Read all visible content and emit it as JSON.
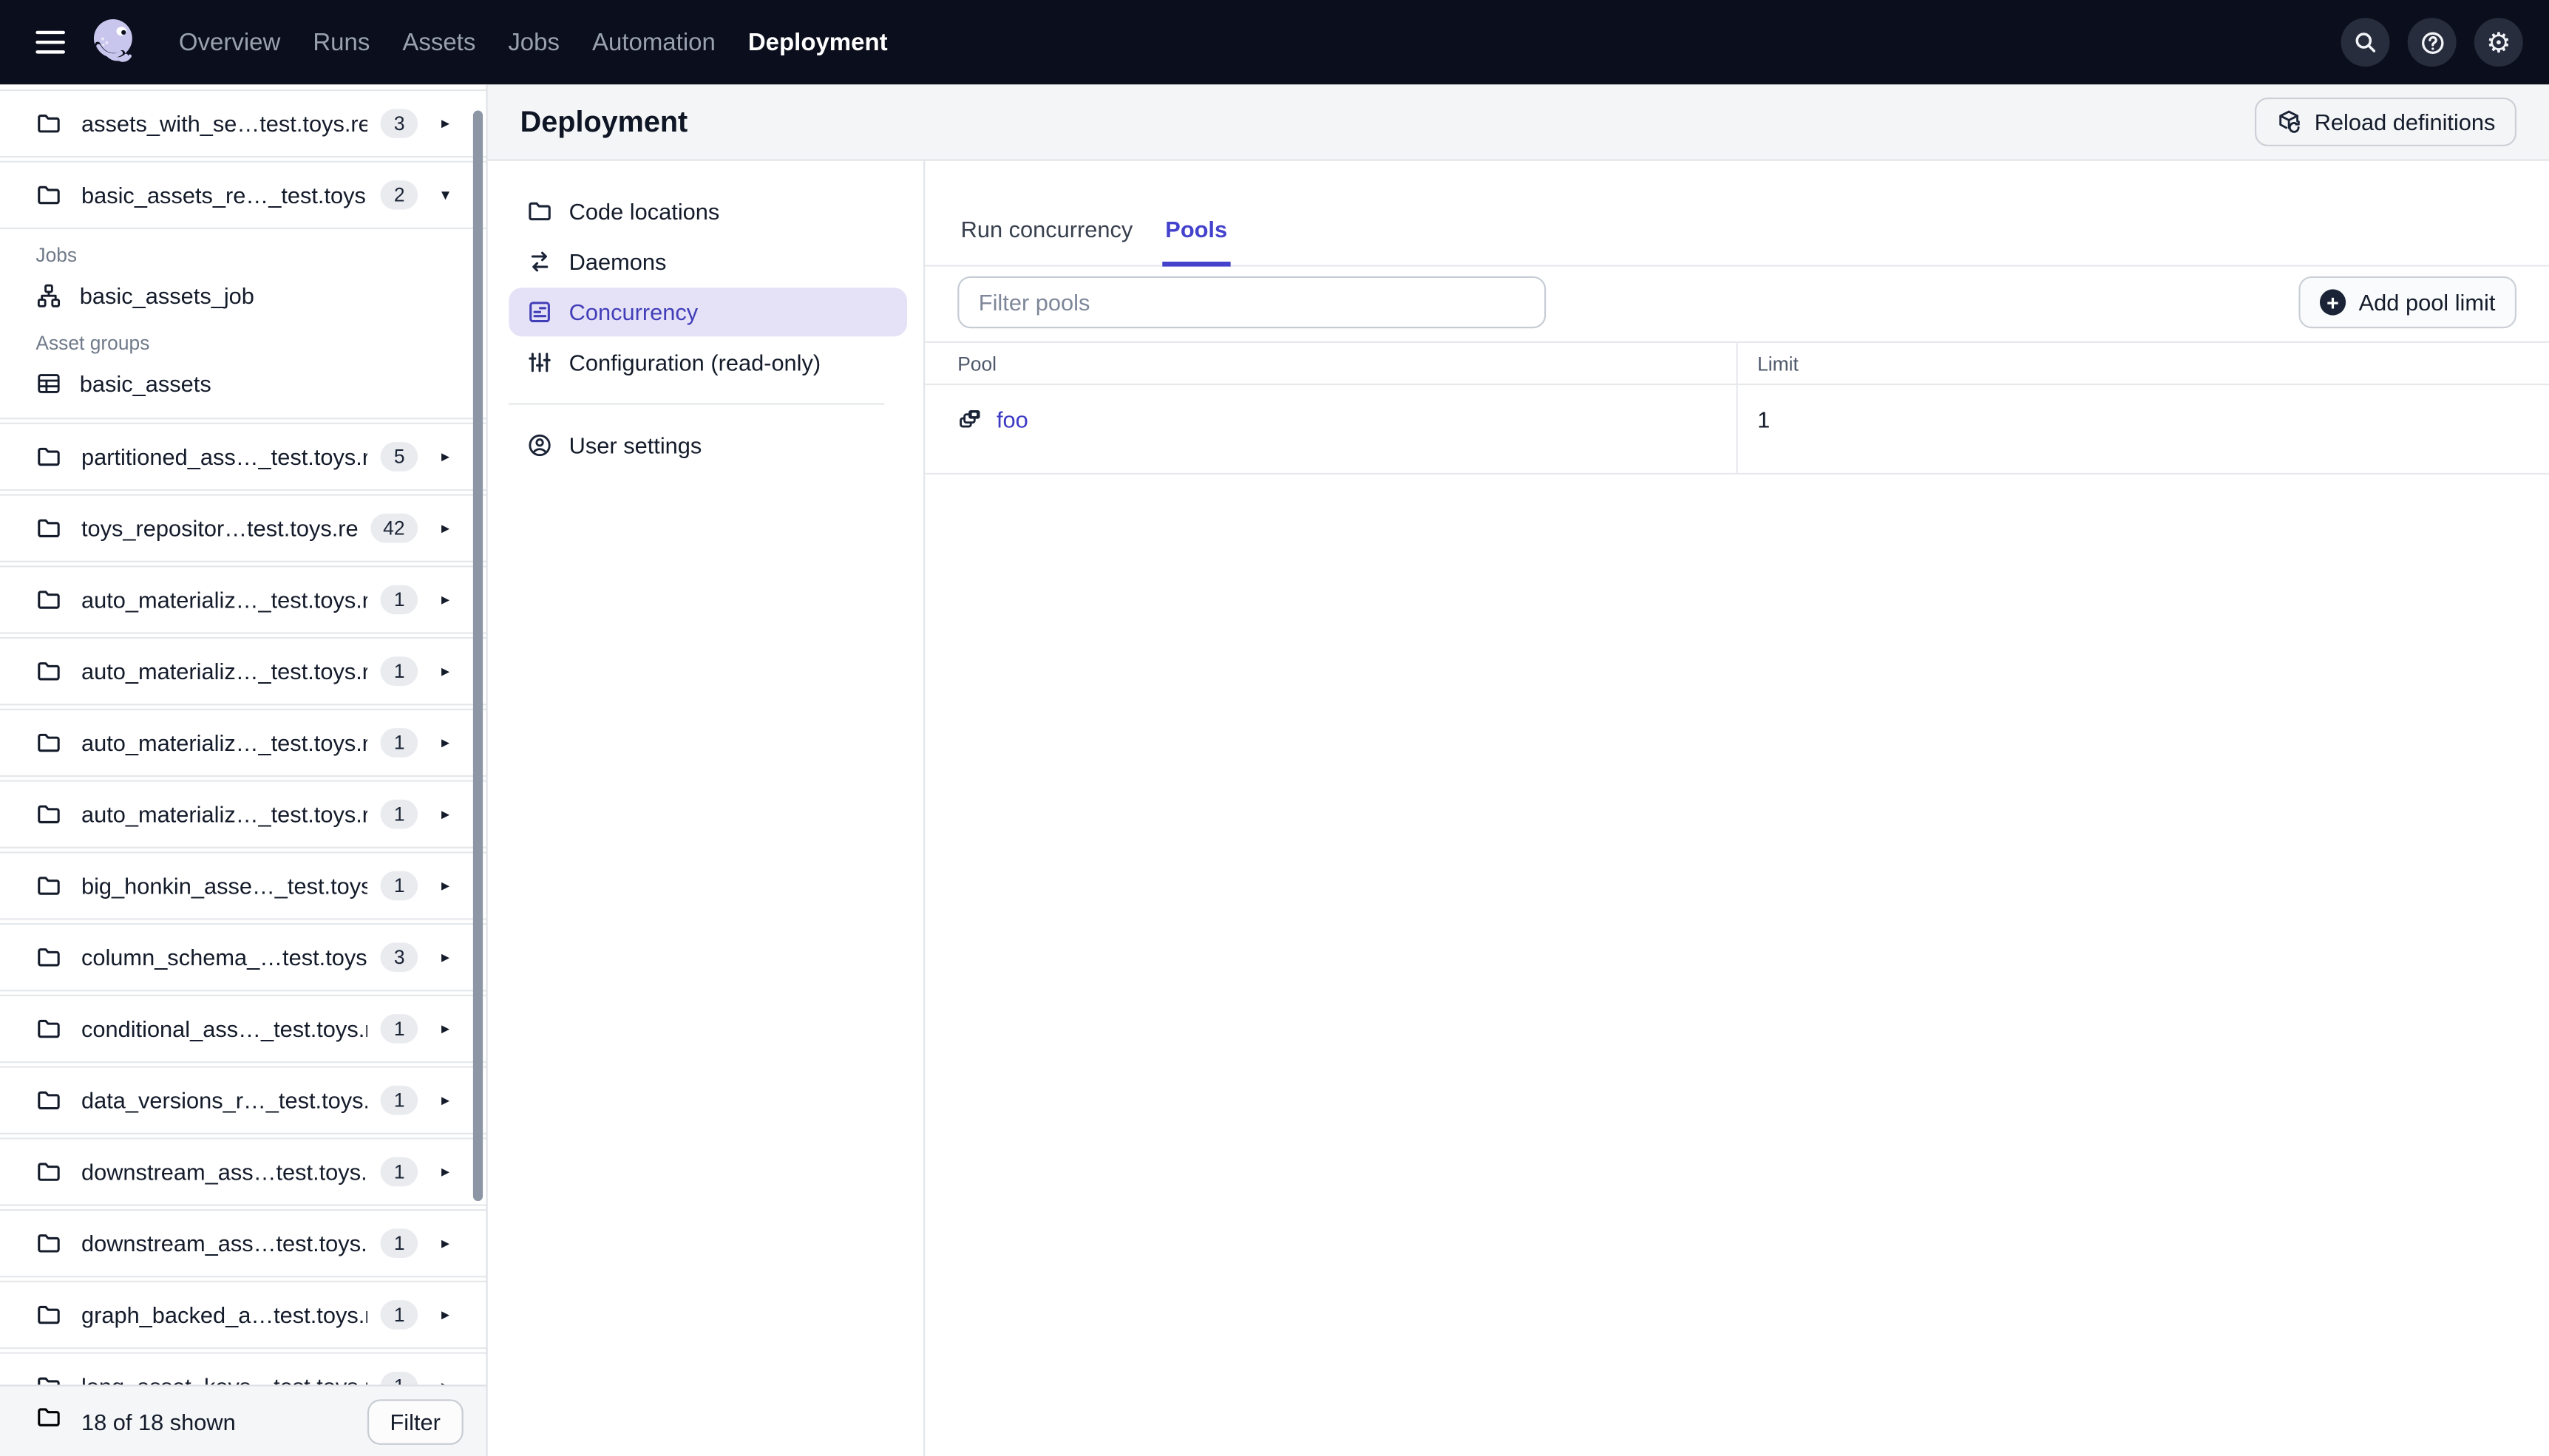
{
  "colors": {
    "topnav_bg": "#0B0E1C",
    "accent": "#4442CC",
    "selected_item_bg": "#E5E2F8",
    "selected_item_text": "#423EB8",
    "link": "#3B38C4",
    "text_dark": "#141B2A",
    "badge_bg": "#E9EBEF",
    "header_bg": "#F4F5F7",
    "footer_bg": "#F5F6F8",
    "logo_lavender": "#C9C6EE"
  },
  "topnav": {
    "items": [
      {
        "label": "Overview",
        "active": false
      },
      {
        "label": "Runs",
        "active": false
      },
      {
        "label": "Assets",
        "active": false
      },
      {
        "label": "Jobs",
        "active": false
      },
      {
        "label": "Automation",
        "active": false
      },
      {
        "label": "Deployment",
        "active": true
      }
    ],
    "right_icons": [
      "search",
      "help",
      "settings"
    ]
  },
  "sidebar": {
    "repos": [
      {
        "name": "assets_with_se…test.toys.repo",
        "badge": "3",
        "expanded": false
      },
      {
        "name": "basic_assets_re…_test.toys.rep",
        "badge": "2",
        "expanded": true
      },
      {
        "name": "partitioned_ass…_test.toys.rep",
        "badge": "5",
        "expanded": false
      },
      {
        "name": "toys_repositor…test.toys.repo",
        "badge": "42",
        "expanded": false
      },
      {
        "name": "auto_materializ…_test.toys.repo",
        "badge": "1",
        "expanded": false
      },
      {
        "name": "auto_materializ…_test.toys.repo",
        "badge": "1",
        "expanded": false
      },
      {
        "name": "auto_materializ…_test.toys.repo",
        "badge": "1",
        "expanded": false
      },
      {
        "name": "auto_materializ…_test.toys.repo",
        "badge": "1",
        "expanded": false
      },
      {
        "name": "big_honkin_asse…_test.toys.rep",
        "badge": "1",
        "expanded": false
      },
      {
        "name": "column_schema_…test.toys.rep",
        "badge": "3",
        "expanded": false
      },
      {
        "name": "conditional_ass…_test.toys.repo",
        "badge": "1",
        "expanded": false
      },
      {
        "name": "data_versions_r…_test.toys.rep",
        "badge": "1",
        "expanded": false
      },
      {
        "name": "downstream_ass…test.toys.rep",
        "badge": "1",
        "expanded": false
      },
      {
        "name": "downstream_ass…test.toys.rep",
        "badge": "1",
        "expanded": false
      },
      {
        "name": "graph_backed_a…test.toys.repo",
        "badge": "1",
        "expanded": false
      },
      {
        "name": "long_asset_keys…test.toys.rep",
        "badge": "1",
        "expanded": false
      }
    ],
    "expanded_content": {
      "jobs_label": "Jobs",
      "jobs": [
        "basic_assets_job"
      ],
      "groups_label": "Asset groups",
      "groups": [
        "basic_assets"
      ]
    },
    "footer": {
      "summary": "18 of 18 shown",
      "filter_label": "Filter"
    }
  },
  "main": {
    "title": "Deployment",
    "reload_label": "Reload definitions",
    "subnav": {
      "items": [
        {
          "label": "Code locations",
          "icon": "folder",
          "active": false
        },
        {
          "label": "Daemons",
          "icon": "swap",
          "active": false
        },
        {
          "label": "Concurrency",
          "icon": "list-box",
          "active": true
        },
        {
          "label": "Configuration (read-only)",
          "icon": "tune",
          "active": false
        }
      ],
      "bottom_items": [
        {
          "label": "User settings",
          "icon": "user",
          "active": false
        }
      ]
    },
    "tabs": [
      {
        "label": "Run concurrency",
        "active": false
      },
      {
        "label": "Pools",
        "active": true
      }
    ],
    "pools": {
      "filter_placeholder": "Filter pools",
      "add_label": "Add pool limit",
      "table": {
        "columns": [
          "Pool",
          "Limit"
        ],
        "rows": [
          {
            "pool": "foo",
            "limit": "1"
          }
        ]
      }
    }
  }
}
